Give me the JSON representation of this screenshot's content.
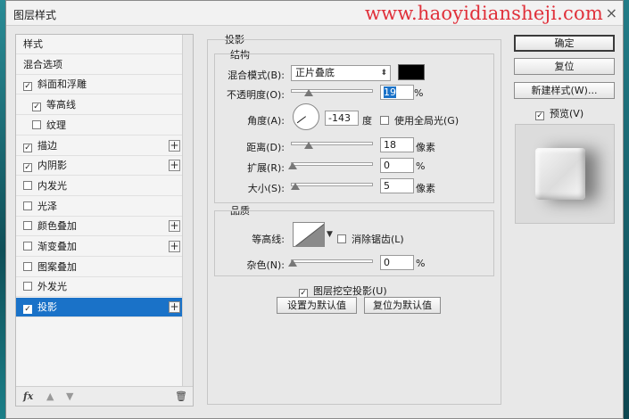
{
  "window": {
    "title": "图层样式",
    "watermark": "www.haoyidiansheji.com",
    "close": "×"
  },
  "styles_panel": {
    "items": [
      {
        "label": "样式",
        "checkbox": false,
        "checked": false,
        "plus": false,
        "sub": false,
        "selected": false
      },
      {
        "label": "混合选项",
        "checkbox": false,
        "checked": false,
        "plus": false,
        "sub": false,
        "selected": false
      },
      {
        "label": "斜面和浮雕",
        "checkbox": true,
        "checked": true,
        "plus": false,
        "sub": false,
        "selected": false
      },
      {
        "label": "等高线",
        "checkbox": true,
        "checked": true,
        "plus": false,
        "sub": true,
        "selected": false
      },
      {
        "label": "纹理",
        "checkbox": true,
        "checked": false,
        "plus": false,
        "sub": true,
        "selected": false
      },
      {
        "label": "描边",
        "checkbox": true,
        "checked": true,
        "plus": true,
        "sub": false,
        "selected": false
      },
      {
        "label": "内阴影",
        "checkbox": true,
        "checked": true,
        "plus": true,
        "sub": false,
        "selected": false
      },
      {
        "label": "内发光",
        "checkbox": true,
        "checked": false,
        "plus": false,
        "sub": false,
        "selected": false
      },
      {
        "label": "光泽",
        "checkbox": true,
        "checked": false,
        "plus": false,
        "sub": false,
        "selected": false
      },
      {
        "label": "颜色叠加",
        "checkbox": true,
        "checked": false,
        "plus": true,
        "sub": false,
        "selected": false
      },
      {
        "label": "渐变叠加",
        "checkbox": true,
        "checked": false,
        "plus": true,
        "sub": false,
        "selected": false
      },
      {
        "label": "图案叠加",
        "checkbox": true,
        "checked": false,
        "plus": false,
        "sub": false,
        "selected": false
      },
      {
        "label": "外发光",
        "checkbox": true,
        "checked": false,
        "plus": false,
        "sub": false,
        "selected": false
      },
      {
        "label": "投影",
        "checkbox": true,
        "checked": true,
        "plus": true,
        "sub": false,
        "selected": true
      }
    ],
    "footer": {
      "fx": "fx",
      "up": "▲",
      "down": "▼",
      "trash": "🗑"
    }
  },
  "drop_shadow": {
    "heading": "投影",
    "structure": {
      "heading": "结构",
      "blend_mode_label": "混合模式(B):",
      "blend_mode_value": "正片叠底",
      "shadow_color": "#000000",
      "opacity_label": "不透明度(O):",
      "opacity_value": "19",
      "opacity_unit": "%",
      "angle_label": "角度(A):",
      "angle_value": "-143",
      "angle_unit": "度",
      "global_light_label": "使用全局光(G)",
      "global_light_checked": false,
      "distance_label": "距离(D):",
      "distance_value": "18",
      "distance_unit": "像素",
      "spread_label": "扩展(R):",
      "spread_value": "0",
      "spread_unit": "%",
      "size_label": "大小(S):",
      "size_value": "5",
      "size_unit": "像素"
    },
    "quality": {
      "heading": "品质",
      "contour_label": "等高线:",
      "antialias_label": "消除锯齿(L)",
      "antialias_checked": false,
      "noise_label": "杂色(N):",
      "noise_value": "0",
      "noise_unit": "%"
    },
    "knockout_label": "图层挖空投影(U)",
    "knockout_checked": true,
    "make_default": "设置为默认值",
    "reset_default": "复位为默认值"
  },
  "buttons": {
    "ok": "确定",
    "reset": "复位",
    "new_style": "新建样式(W)...",
    "preview_label": "预览(V)",
    "preview_checked": true
  },
  "check_mark": "✓"
}
